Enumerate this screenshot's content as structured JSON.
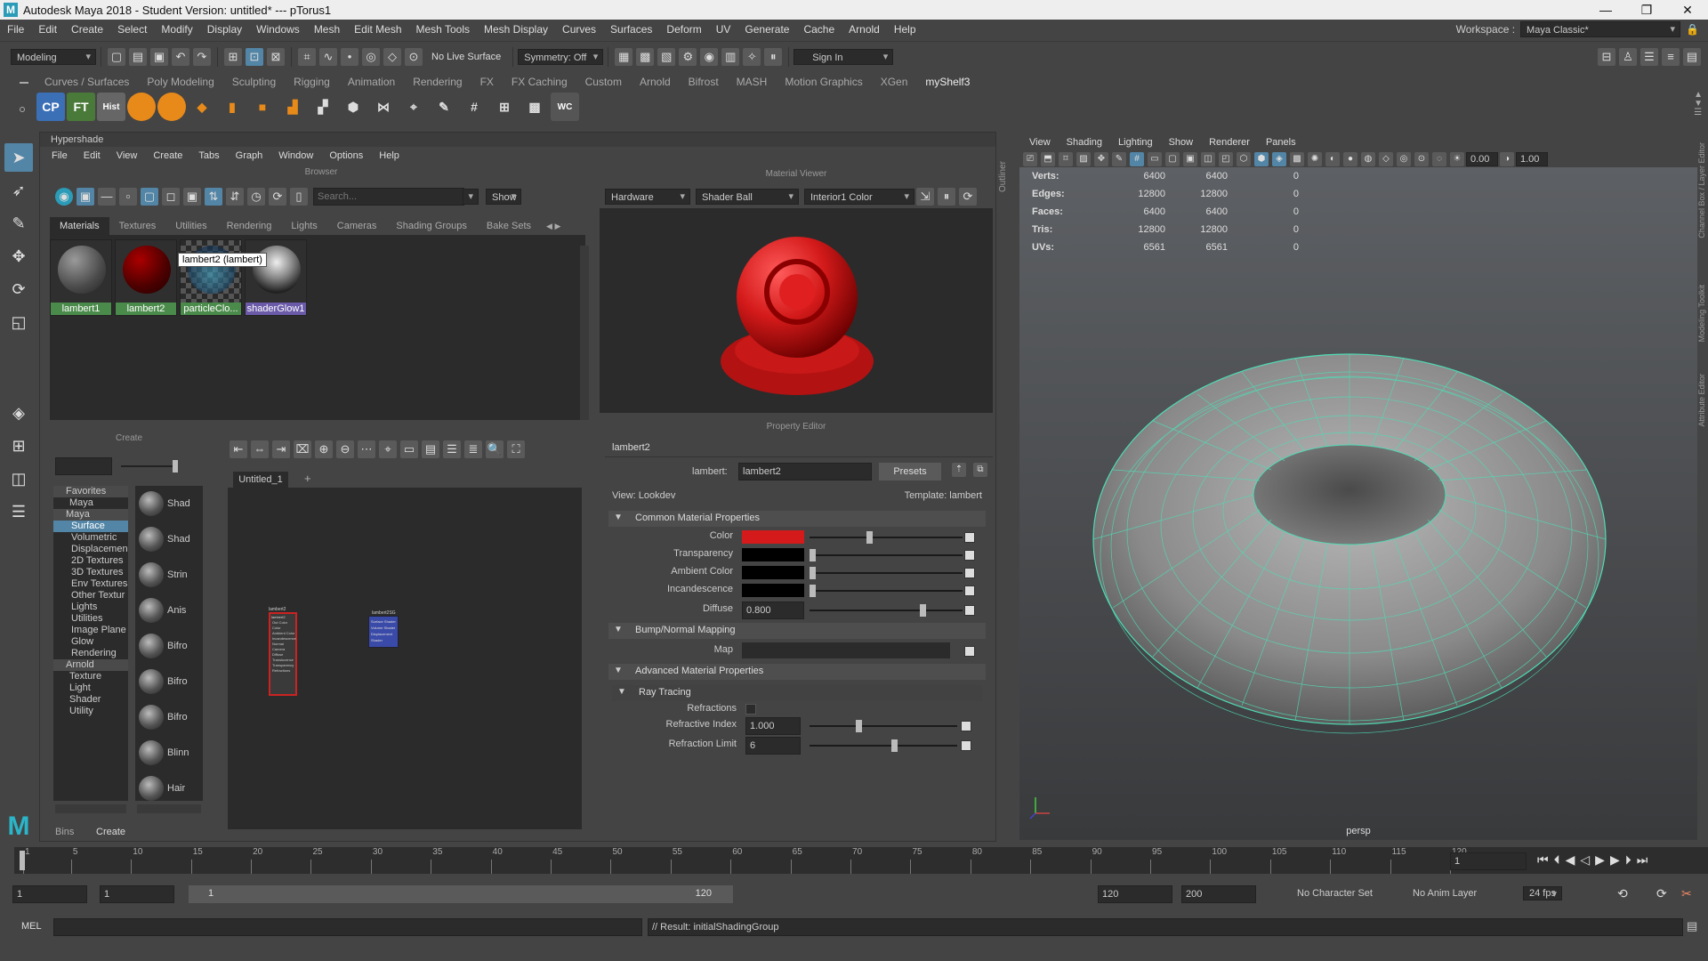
{
  "window": {
    "title": "Autodesk Maya 2018 - Student Version: untitled*  ---  pTorus1",
    "logo": "M"
  },
  "menubar": {
    "items": [
      "File",
      "Edit",
      "Create",
      "Select",
      "Modify",
      "Display",
      "Windows",
      "Mesh",
      "Edit Mesh",
      "Mesh Tools",
      "Mesh Display",
      "Curves",
      "Surfaces",
      "Deform",
      "UV",
      "Generate",
      "Cache",
      "Arnold",
      "Help"
    ],
    "workspace_label": "Workspace :",
    "workspace_value": "Maya Classic*"
  },
  "statusline": {
    "mode": "Modeling",
    "live_surface": "No Live Surface",
    "symmetry": "Symmetry: Off",
    "sign_in": "Sign In"
  },
  "shelf": {
    "tabs": [
      "Curves / Surfaces",
      "Poly Modeling",
      "Sculpting",
      "Rigging",
      "Animation",
      "Rendering",
      "FX",
      "FX Caching",
      "Custom",
      "Arnold",
      "Bifrost",
      "MASH",
      "Motion Graphics",
      "XGen",
      "myShelf3"
    ],
    "active_tab": "myShelf3",
    "icons": [
      {
        "label": "CP",
        "color": "#3b6fb6"
      },
      {
        "label": "FT",
        "color": "#5a5a5a"
      },
      {
        "label": "Hist",
        "color": "#666"
      }
    ]
  },
  "hypershade": {
    "title": "Hypershade",
    "menu": [
      "File",
      "Edit",
      "View",
      "Create",
      "Tabs",
      "Graph",
      "Window",
      "Options",
      "Help"
    ],
    "browser": {
      "title": "Browser",
      "search_placeholder": "Search...",
      "show_btn": "Show",
      "tabs": [
        "Materials",
        "Textures",
        "Utilities",
        "Rendering",
        "Lights",
        "Cameras",
        "Shading Groups",
        "Bake Sets"
      ],
      "materials": [
        {
          "name": "lambert1",
          "color": "#555"
        },
        {
          "name": "lambert2",
          "color": "#7a0000"
        },
        {
          "name": "particleClo...",
          "color": "#3a5a6a"
        },
        {
          "name": "shaderGlow1",
          "color": "#888"
        }
      ],
      "tooltip": "lambert2 (lambert)"
    },
    "create": {
      "title": "Create",
      "tree": [
        "Favorites",
        "Maya",
        "Maya",
        "Surface",
        "Volumetric",
        "Displacemen",
        "2D Textures",
        "3D Textures",
        "Env Textures",
        "Other Textur",
        "Lights",
        "Utilities",
        "Image Plane",
        "Glow",
        "Rendering",
        "Arnold",
        "Texture",
        "Light",
        "Shader",
        "Utility"
      ],
      "selected": "Surface",
      "shaders": [
        "Shad",
        "Shad",
        "Strin",
        "Anis",
        "Bifro",
        "Bifro",
        "Bifro",
        "Blinn",
        "Hair"
      ]
    },
    "graph": {
      "tab": "Untitled_1",
      "node1_title": "lambert2",
      "node1_ports": [
        "Out Color",
        "Color",
        "Ambient Color",
        "Incandescence",
        "Normal Camera",
        "Diffuse",
        "Translucence",
        "Transparency",
        "Refractions"
      ],
      "node2_title": "lambert2SG",
      "node2_ports": [
        "Surface Shader",
        "Volume Shader",
        "Displacement Shader"
      ]
    },
    "material_viewer": {
      "title": "Material Viewer",
      "renderer": "Hardware",
      "shape": "Shader Ball",
      "env": "Interior1 Color"
    },
    "property_editor": {
      "title": "Property Editor",
      "node": "lambert2",
      "label_lambert": "lambert:",
      "lambert_value": "lambert2",
      "presets": "Presets",
      "view": "View: Lookdev",
      "template": "Template: lambert",
      "sections": [
        "Common Material Properties",
        "Bump/Normal Mapping",
        "Advanced Material Properties",
        "Ray Tracing"
      ],
      "props": [
        {
          "label": "Color"
        },
        {
          "label": "Transparency"
        },
        {
          "label": "Ambient Color"
        },
        {
          "label": "Incandescence"
        },
        {
          "label": "Diffuse",
          "value": "0.800"
        }
      ],
      "map_label": "Map",
      "refractions_label": "Refractions",
      "refr_index_label": "Refractive Index",
      "refr_index": "1.000",
      "refr_limit_label": "Refraction Limit",
      "refr_limit": "6"
    },
    "footer": {
      "bins": "Bins",
      "create": "Create"
    }
  },
  "viewport": {
    "menu": [
      "View",
      "Shading",
      "Lighting",
      "Show",
      "Renderer",
      "Panels"
    ],
    "camera": "persp",
    "field1": "0.00",
    "field2": "1.00",
    "stats": [
      {
        "k": "Verts:",
        "a": "6400",
        "b": "6400",
        "c": "0"
      },
      {
        "k": "Edges:",
        "a": "12800",
        "b": "12800",
        "c": "0"
      },
      {
        "k": "Faces:",
        "a": "6400",
        "b": "6400",
        "c": "0"
      },
      {
        "k": "Tris:",
        "a": "12800",
        "b": "12800",
        "c": "0"
      },
      {
        "k": "UVs:",
        "a": "6561",
        "b": "6561",
        "c": "0"
      }
    ]
  },
  "sidebar": {
    "labels": [
      "Channel Box / Layer Editor",
      "Modeling Toolkit",
      "Attribute Editor"
    ],
    "outliner": "Outliner"
  },
  "timeline": {
    "ticks": [
      "1",
      "5",
      "10",
      "15",
      "20",
      "25",
      "30",
      "35",
      "40",
      "45",
      "50",
      "55",
      "60",
      "65",
      "70",
      "75",
      "80",
      "85",
      "90",
      "95",
      "100",
      "105",
      "110",
      "115",
      "120"
    ],
    "current": "1"
  },
  "range": {
    "start": "1",
    "start2": "1",
    "slider_start": "1",
    "slider_end": "120",
    "end": "120",
    "end2": "200",
    "char_set": "No Character Set",
    "anim_layer": "No Anim Layer",
    "fps": "24 fps"
  },
  "cmd": {
    "mel": "MEL",
    "result": "// Result: initialShadingGroup"
  },
  "colors": {
    "accent": "#5285a6",
    "red": "#d41a1a",
    "wire": "#4fdcb4"
  }
}
